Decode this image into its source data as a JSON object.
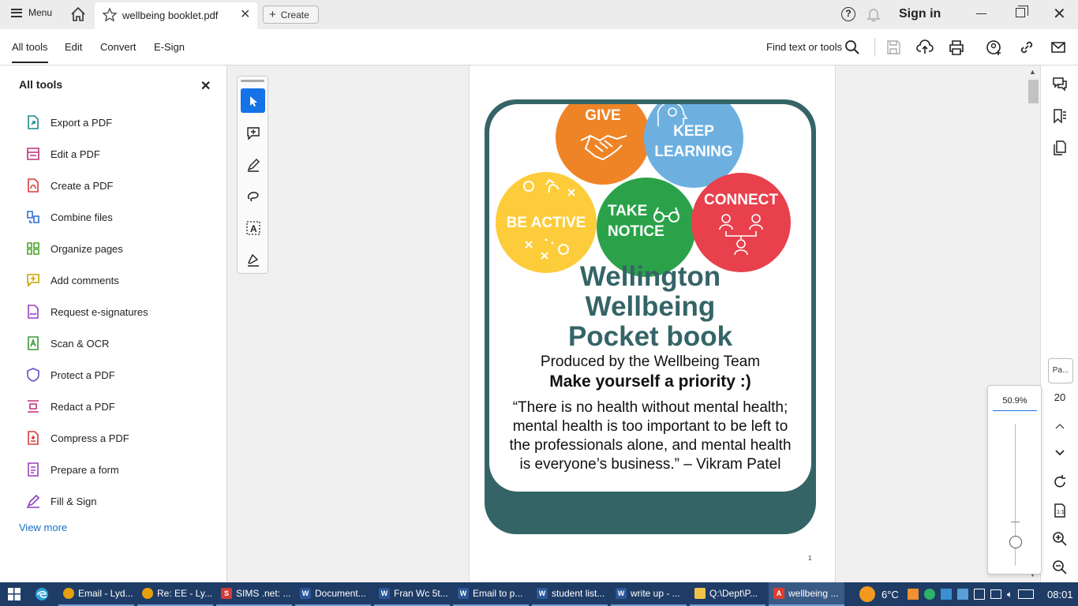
{
  "titlebar": {
    "menu_label": "Menu",
    "tab_title": "wellbeing booklet.pdf",
    "create_label": "Create",
    "signin_label": "Sign in"
  },
  "toolbar": {
    "tabs": [
      "All tools",
      "Edit",
      "Convert",
      "E-Sign"
    ],
    "find_label": "Find text or tools"
  },
  "leftpanel": {
    "title": "All tools",
    "items": [
      {
        "label": "Export a PDF",
        "icon": "export-pdf-icon",
        "color": "#1a8c8c"
      },
      {
        "label": "Edit a PDF",
        "icon": "edit-pdf-icon",
        "color": "#c2307a"
      },
      {
        "label": "Create a PDF",
        "icon": "create-pdf-icon",
        "color": "#d93a3a"
      },
      {
        "label": "Combine files",
        "icon": "combine-files-icon",
        "color": "#2f6dd0"
      },
      {
        "label": "Organize pages",
        "icon": "organize-pages-icon",
        "color": "#4da32c"
      },
      {
        "label": "Add comments",
        "icon": "add-comments-icon",
        "color": "#c8a400"
      },
      {
        "label": "Request e-signatures",
        "icon": "request-esign-icon",
        "color": "#9b3fc2"
      },
      {
        "label": "Scan & OCR",
        "icon": "scan-ocr-icon",
        "color": "#3a9b3a"
      },
      {
        "label": "Protect a PDF",
        "icon": "protect-pdf-icon",
        "color": "#6a4bc4"
      },
      {
        "label": "Redact a PDF",
        "icon": "redact-pdf-icon",
        "color": "#c2307a"
      },
      {
        "label": "Compress a PDF",
        "icon": "compress-pdf-icon",
        "color": "#d93a3a"
      },
      {
        "label": "Prepare a form",
        "icon": "prepare-form-icon",
        "color": "#9b3fc2"
      },
      {
        "label": "Fill & Sign",
        "icon": "fill-sign-icon",
        "color": "#8a3fc2"
      }
    ],
    "view_more": "View more"
  },
  "document": {
    "circles": [
      {
        "label_lines": [
          "GIVE"
        ],
        "color": "#ef8427"
      },
      {
        "label_lines": [
          "KEEP",
          "LEARNING"
        ],
        "color": "#6db0e0"
      },
      {
        "label_lines": [
          "BE ACTIVE"
        ],
        "color": "#fdcc3a"
      },
      {
        "label_lines": [
          "TAKE",
          "NOTICE"
        ],
        "color": "#2ba24a"
      },
      {
        "label_lines": [
          "CONNECT"
        ],
        "color": "#e8414d"
      }
    ],
    "headline_lines": [
      "Wellington",
      "Wellbeing",
      "Pocket book"
    ],
    "produced_by": "Produced by the Wellbeing Team",
    "priority": "Make yourself a priority :)",
    "quote_lines": [
      "“There is no health without mental health;",
      "mental health is too important to be left to",
      "the professionals alone, and mental health",
      "is everyone’s business.” – Vikram Patel"
    ],
    "page_number": "1",
    "accent_color": "#356467"
  },
  "rightrail": {
    "page_box": "Pa...",
    "page_count": "20"
  },
  "zoom": {
    "value": "50.9%"
  },
  "taskbar": {
    "apps": [
      {
        "label": "Email - Lyd...",
        "icon": "chrome-icon"
      },
      {
        "label": "Re: EE - Ly...",
        "icon": "chrome-icon"
      },
      {
        "label": "SIMS .net: ...",
        "icon": "sims-icon"
      },
      {
        "label": "Document...",
        "icon": "word-icon"
      },
      {
        "label": "Fran Wc 5t...",
        "icon": "word-icon"
      },
      {
        "label": "Email to p...",
        "icon": "word-icon"
      },
      {
        "label": "student list...",
        "icon": "word-icon"
      },
      {
        "label": "write up - ...",
        "icon": "word-icon"
      },
      {
        "label": "Q:\\Dept\\P...",
        "icon": "folder-icon"
      },
      {
        "label": "wellbeing ...",
        "icon": "acrobat-icon"
      }
    ],
    "temperature": "6°C",
    "clock": "08:01"
  }
}
